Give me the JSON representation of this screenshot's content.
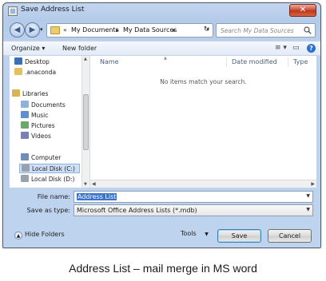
{
  "window": {
    "title": "Save Address List",
    "close_symbol": "✕"
  },
  "address": {
    "prefix": "«",
    "crumbs": [
      "My Documents",
      "My Data Sources"
    ],
    "separator": "▸"
  },
  "search": {
    "placeholder": "Search My Data Sources"
  },
  "toolbar": {
    "organize": "Organize ▾",
    "new_folder": "New folder",
    "views_icon": "≡ ▾"
  },
  "nav_pane": {
    "items": [
      {
        "label": "Desktop",
        "icon": "desktop-icon",
        "color": "#3a6fb5"
      },
      {
        "label": ".anaconda",
        "icon": "folder-icon",
        "color": "#e2c15e"
      },
      {
        "label": "Libraries",
        "icon": "libraries-icon",
        "color": "#d8b457"
      },
      {
        "label": "Documents",
        "icon": "documents-icon",
        "color": "#8eb2dc"
      },
      {
        "label": "Music",
        "icon": "music-icon",
        "color": "#5d8fd1"
      },
      {
        "label": "Pictures",
        "icon": "pictures-icon",
        "color": "#6aa86a"
      },
      {
        "label": "Videos",
        "icon": "videos-icon",
        "color": "#7a7fb8"
      },
      {
        "label": "Computer",
        "icon": "computer-icon",
        "color": "#6d8fb5"
      },
      {
        "label": "Local Disk (C:)",
        "icon": "disk-icon",
        "color": "#9aa3ad"
      },
      {
        "label": "Local Disk (D:)",
        "icon": "disk-icon",
        "color": "#9aa3ad"
      }
    ]
  },
  "file_list": {
    "columns": [
      "Name",
      "Date modified",
      "Type"
    ],
    "empty_message": "No items match your search."
  },
  "form": {
    "file_name_label": "File name:",
    "file_name_value": "Address List",
    "save_as_type_label": "Save as type:",
    "save_as_type_value": "Microsoft Office Address Lists (*.mdb)"
  },
  "footer": {
    "hide_folders": "Hide Folders",
    "tools": "Tools",
    "save": "Save",
    "cancel": "Cancel"
  },
  "caption": "Address List – mail merge in MS word"
}
